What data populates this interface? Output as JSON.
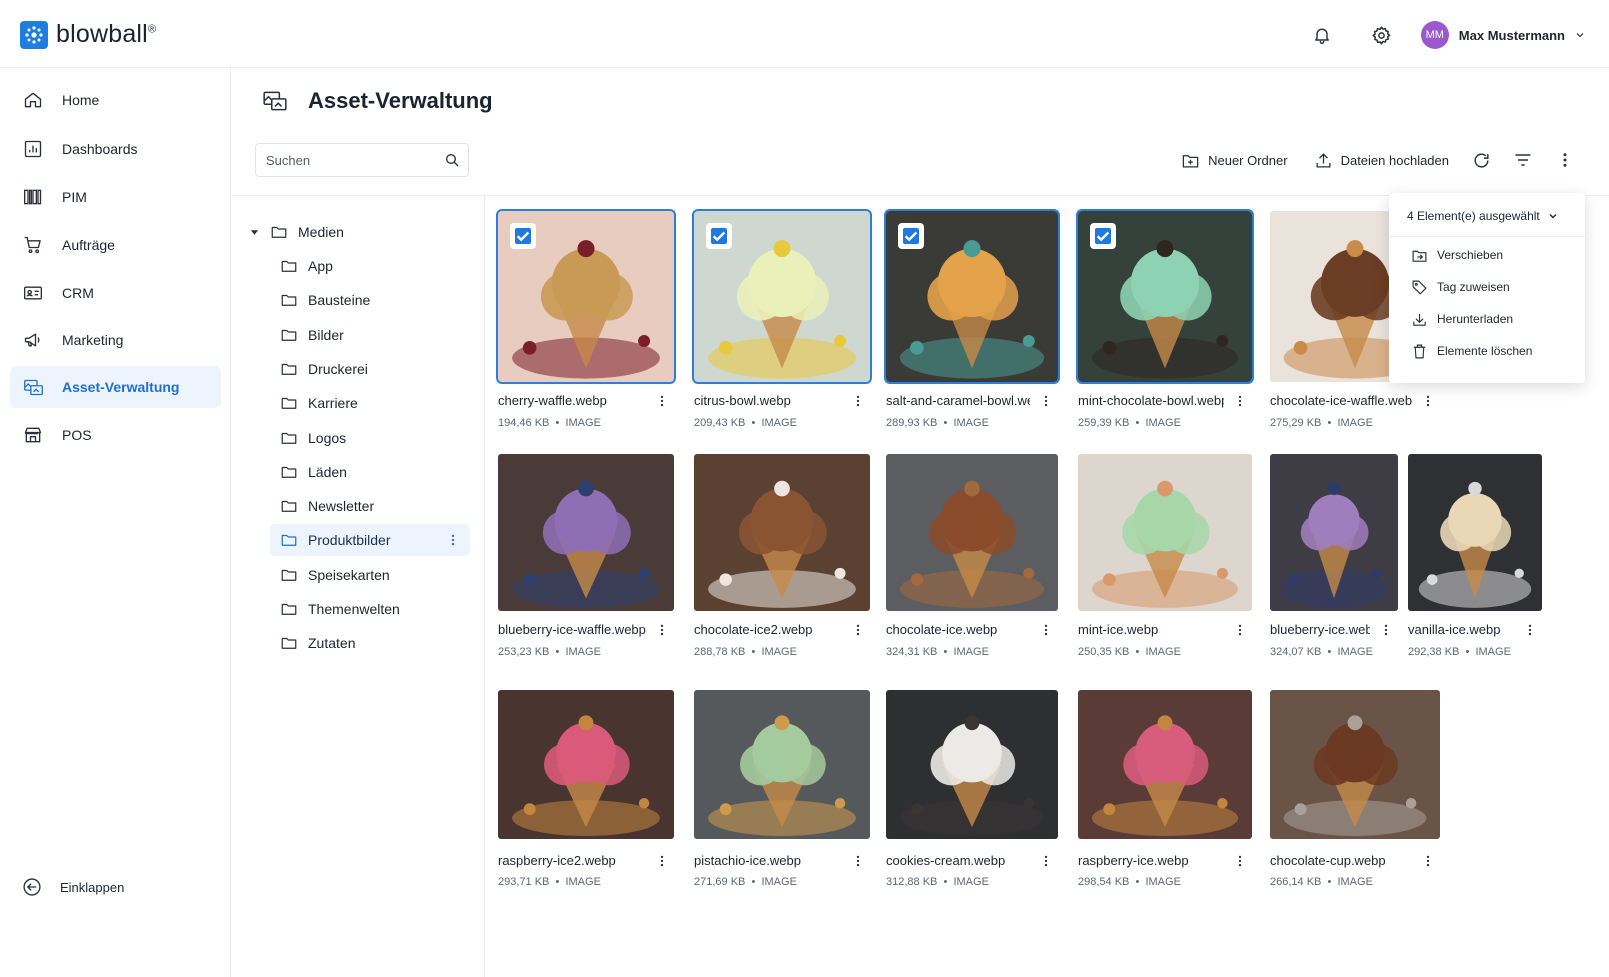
{
  "app": {
    "brand": "blowball",
    "brand_mark": "®",
    "brand_color": "#1e7ee0"
  },
  "header": {
    "user_initials": "MM",
    "user_name": "Max Mustermann",
    "avatar_color": "#9b59d0",
    "icons": [
      "bell-icon",
      "gear-icon",
      "chevron-down-icon"
    ]
  },
  "sidebar": {
    "items": [
      {
        "label": "Home",
        "icon": "home-icon"
      },
      {
        "label": "Dashboards",
        "icon": "dashboard-icon"
      },
      {
        "label": "PIM",
        "icon": "columns-icon"
      },
      {
        "label": "Aufträge",
        "icon": "cart-icon"
      },
      {
        "label": "CRM",
        "icon": "contact-card-icon"
      },
      {
        "label": "Marketing",
        "icon": "megaphone-icon"
      },
      {
        "label": "Asset-Verwaltung",
        "icon": "assets-icon",
        "active": true
      },
      {
        "label": "POS",
        "icon": "store-icon"
      }
    ],
    "collapse_label": "Einklappen"
  },
  "main": {
    "title": "Asset-Verwaltung",
    "search_placeholder": "Suchen",
    "toolbar": {
      "new_folder": "Neuer Ordner",
      "upload": "Dateien hochladen"
    }
  },
  "tree": {
    "root": "Medien",
    "folders": [
      "App",
      "Bausteine",
      "Bilder",
      "Druckerei",
      "Karriere",
      "Logos",
      "Läden",
      "Newsletter",
      "Produktbilder",
      "Speisekarten",
      "Themenwelten",
      "Zutaten"
    ],
    "active": "Produktbilder"
  },
  "selection_menu": {
    "summary": "4 Element(e) ausgewählt",
    "items": [
      {
        "label": "Verschieben",
        "icon": "move-folder-icon"
      },
      {
        "label": "Tag zuweisen",
        "icon": "tag-icon"
      },
      {
        "label": "Herunterladen",
        "icon": "download-icon"
      },
      {
        "label": "Elemente löschen",
        "icon": "trash-icon"
      }
    ]
  },
  "assets": [
    {
      "name": "cherry-waffle.webp",
      "size": "194,46 KB",
      "type": "IMAGE",
      "selected": true,
      "bg": "#e9ccc0",
      "fg": "#c99a55",
      "accent": "#7a1e28"
    },
    {
      "name": "citrus-bowl.webp",
      "size": "209,43 KB",
      "type": "IMAGE",
      "selected": true,
      "bg": "#cfd8d0",
      "fg": "#eaf0b9",
      "accent": "#e9c93c"
    },
    {
      "name": "salt-and-caramel-bowl.webp",
      "size": "289,93 KB",
      "type": "IMAGE",
      "selected": true,
      "bg": "#3a3a37",
      "fg": "#e4a24a",
      "accent": "#4a9a96"
    },
    {
      "name": "mint-chocolate-bowl.webp",
      "size": "259,39 KB",
      "type": "IMAGE",
      "selected": true,
      "bg": "#34423b",
      "fg": "#8ed2b4",
      "accent": "#2f2622"
    },
    {
      "name": "chocolate-ice-waffle.webp",
      "size": "275,29 KB",
      "type": "IMAGE",
      "selected": false,
      "bg": "#eae3dc",
      "fg": "#6b3d24",
      "accent": "#c98b4a"
    },
    {
      "name": "blueberry-ice-waffle.webp",
      "size": "253,23 KB",
      "type": "IMAGE",
      "selected": false,
      "bg": "#4a3b38",
      "fg": "#8e6fb5",
      "accent": "#2c3f6e"
    },
    {
      "name": "chocolate-ice2.webp",
      "size": "288,78 KB",
      "type": "IMAGE",
      "selected": false,
      "bg": "#5a4132",
      "fg": "#8a5433",
      "accent": "#ece6de"
    },
    {
      "name": "chocolate-ice.webp",
      "size": "324,31 KB",
      "type": "IMAGE",
      "selected": false,
      "bg": "#5b5d60",
      "fg": "#8a4c2c",
      "accent": "#a2683e"
    },
    {
      "name": "mint-ice.webp",
      "size": "250,35 KB",
      "type": "IMAGE",
      "selected": false,
      "bg": "#dcd6cf",
      "fg": "#a7d7a8",
      "accent": "#d9996a"
    },
    {
      "name": "blueberry-ice.webp",
      "size": "324,07 KB",
      "type": "IMAGE",
      "selected": false,
      "bg": "#3e3c44",
      "fg": "#a07dbc",
      "accent": "#2d3b6c"
    },
    {
      "name": "vanilla-ice.webp",
      "size": "292,38 KB",
      "type": "IMAGE",
      "selected": false,
      "bg": "#2f3033",
      "fg": "#ead7b6",
      "accent": "#d8d9db"
    },
    {
      "name": "raspberry-ice2.webp",
      "size": "293,71 KB",
      "type": "IMAGE",
      "selected": false,
      "bg": "#4a3430",
      "fg": "#d95a7a",
      "accent": "#c2863f"
    },
    {
      "name": "pistachio-ice.webp",
      "size": "271,69 KB",
      "type": "IMAGE",
      "selected": false,
      "bg": "#56595b",
      "fg": "#a4ca9e",
      "accent": "#cf9a4e"
    },
    {
      "name": "cookies-cream.webp",
      "size": "312,88 KB",
      "type": "IMAGE",
      "selected": false,
      "bg": "#2e2f31",
      "fg": "#eceae6",
      "accent": "#3a3433"
    },
    {
      "name": "raspberry-ice.webp",
      "size": "298,54 KB",
      "type": "IMAGE",
      "selected": false,
      "bg": "#5a3b37",
      "fg": "#d85c7c",
      "accent": "#c2863f"
    },
    {
      "name": "chocolate-cup.webp",
      "size": "266,14 KB",
      "type": "IMAGE",
      "selected": false,
      "bg": "#6a5448",
      "fg": "#6b3a22",
      "accent": "#a9a19a"
    }
  ]
}
